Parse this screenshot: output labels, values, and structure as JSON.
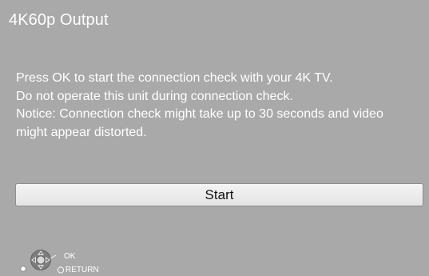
{
  "screen": {
    "title": "4K60p Output",
    "message_lines": [
      "Press OK to start the connection check with your 4K TV.",
      "Do not operate this unit during connection check.",
      "Notice: Connection check might take up to 30 seconds and video",
      "might appear distorted."
    ],
    "start_button_label": "Start"
  },
  "legend": {
    "ok_label": "OK",
    "return_label": "RETURN",
    "icons": [
      "dpad-icon",
      "return-circle-icon"
    ]
  },
  "colors": {
    "background": "#a9a9a9",
    "text": "#ffffff",
    "button_bg": "#ececec",
    "button_text": "#111111"
  }
}
